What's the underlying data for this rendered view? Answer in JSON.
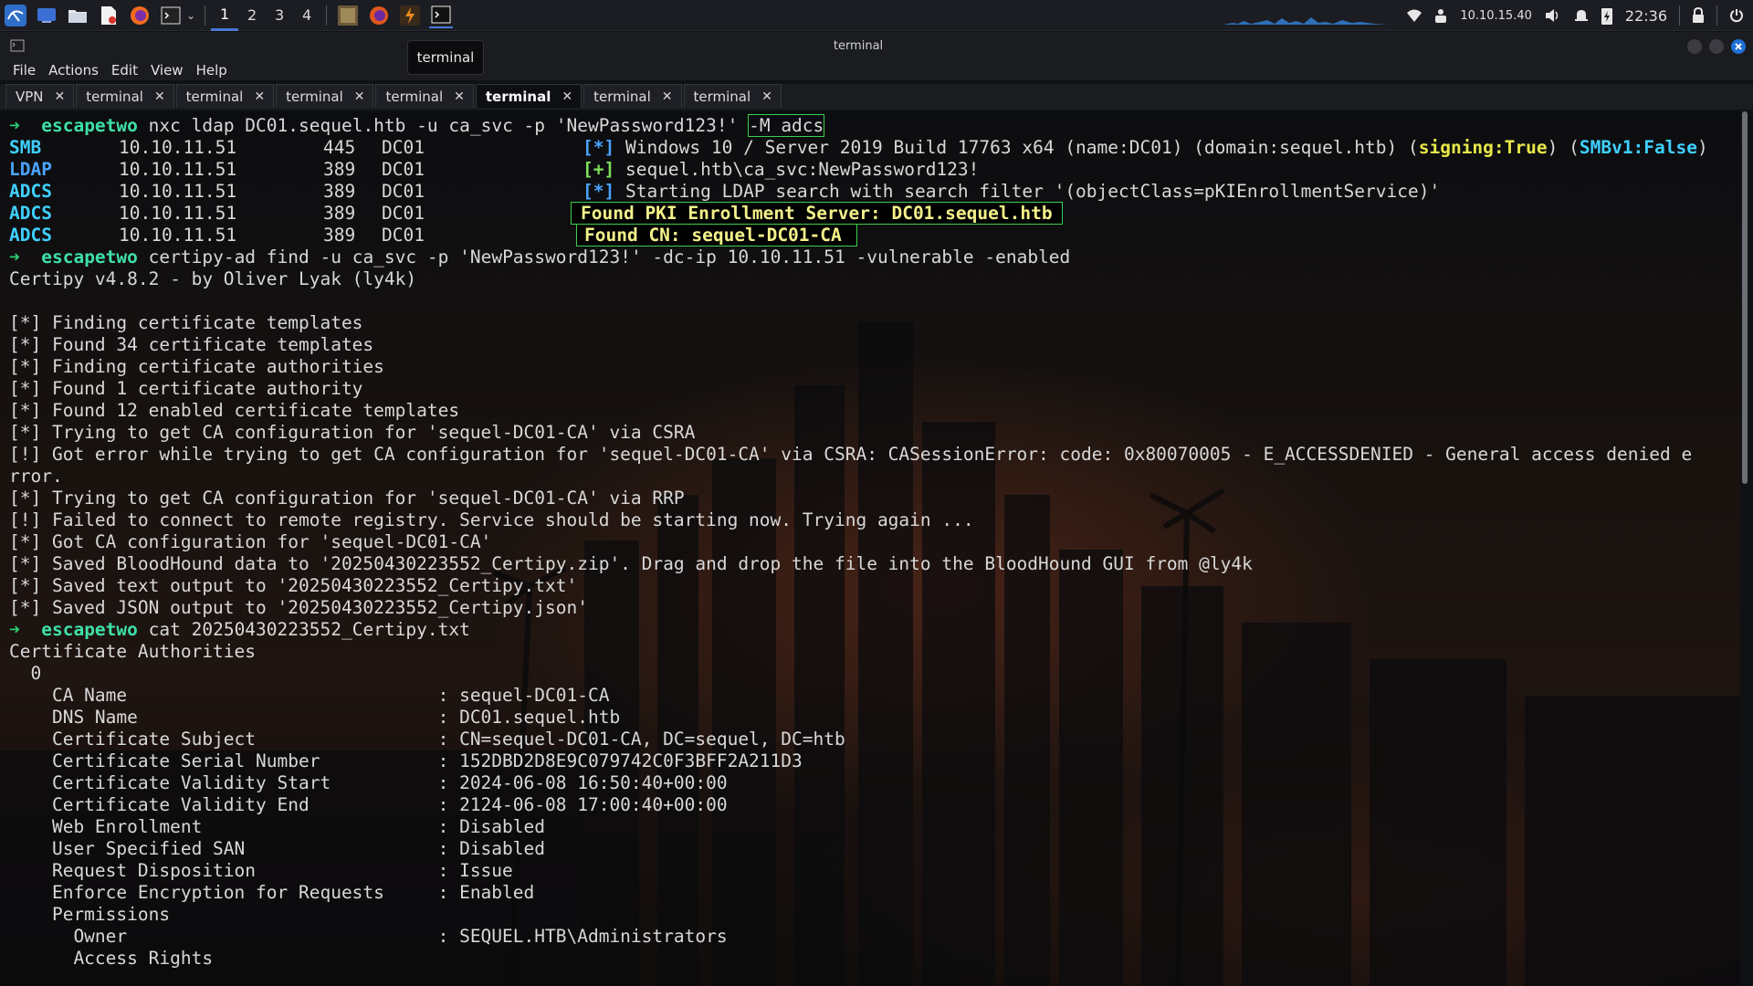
{
  "panel": {
    "workspaces": [
      "1",
      "2",
      "3",
      "4"
    ],
    "active_workspace": "1",
    "ip": "10.10.15.40",
    "clock": "22:36"
  },
  "window": {
    "title": "terminal",
    "tooltip": "terminal"
  },
  "menu": [
    "File",
    "Actions",
    "Edit",
    "View",
    "Help"
  ],
  "tabs": [
    {
      "label": "VPN"
    },
    {
      "label": "terminal"
    },
    {
      "label": "terminal"
    },
    {
      "label": "terminal"
    },
    {
      "label": "terminal"
    },
    {
      "label": "terminal",
      "active": true
    },
    {
      "label": "terminal"
    },
    {
      "label": "terminal"
    }
  ],
  "terminal": {
    "prompt_symbol": "➜",
    "hostname": "escapetwo",
    "cmd1": " nxc ldap DC01.sequel.htb -u ca_svc -p 'NewPassword123!' ",
    "cmd1_flag": "-M adcs",
    "nxc": [
      {
        "proto": "SMB",
        "ip": "10.10.11.51",
        "port": "445",
        "host": "DC01",
        "mark": "[*]",
        "msg_a": " Windows 10 / Server 2019 Build 17763 x64 (name:DC01) (domain:sequel.htb) (",
        "signing": "signing:True",
        "msg_b": ") (",
        "smbv1": "SMBv1:False",
        "msg_c": ")"
      },
      {
        "proto": "LDAP",
        "ip": "10.10.11.51",
        "port": "389",
        "host": "DC01",
        "mark": "[+]",
        "msg": " sequel.htb\\ca_svc:NewPassword123!"
      },
      {
        "proto": "ADCS",
        "ip": "10.10.11.51",
        "port": "389",
        "host": "DC01",
        "mark": "[*]",
        "msg": " Starting LDAP search with search filter '(objectClass=pKIEnrollmentService)'"
      },
      {
        "proto": "ADCS",
        "ip": "10.10.11.51",
        "port": "389",
        "host": "DC01",
        "found": "Found PKI Enrollment Server: DC01.sequel.htb"
      },
      {
        "proto": "ADCS",
        "ip": "10.10.11.51",
        "port": "389",
        "host": "DC01",
        "found": "Found CN: sequel-DC01-CA"
      }
    ],
    "cmd2": " certipy-ad find -u ca_svc -p 'NewPassword123!' -dc-ip 10.10.11.51 -vulnerable -enabled",
    "certipy_out": [
      "Certipy v4.8.2 - by Oliver Lyak (ly4k)",
      "",
      "[*] Finding certificate templates",
      "[*] Found 34 certificate templates",
      "[*] Finding certificate authorities",
      "[*] Found 1 certificate authority",
      "[*] Found 12 enabled certificate templates",
      "[*] Trying to get CA configuration for 'sequel-DC01-CA' via CSRA",
      "[!] Got error while trying to get CA configuration for 'sequel-DC01-CA' via CSRA: CASessionError: code: 0x80070005 - E_ACCESSDENIED - General access denied e",
      "rror.",
      "[*] Trying to get CA configuration for 'sequel-DC01-CA' via RRP",
      "[!] Failed to connect to remote registry. Service should be starting now. Trying again ...",
      "[*] Got CA configuration for 'sequel-DC01-CA'",
      "[*] Saved BloodHound data to '20250430223552_Certipy.zip'. Drag and drop the file into the BloodHound GUI from @ly4k",
      "[*] Saved text output to '20250430223552_Certipy.txt'",
      "[*] Saved JSON output to '20250430223552_Certipy.json'"
    ],
    "cmd3": " cat 20250430223552_Certipy.txt",
    "cat_out": [
      "Certificate Authorities",
      "  0",
      "    CA Name                             : sequel-DC01-CA",
      "    DNS Name                            : DC01.sequel.htb",
      "    Certificate Subject                 : CN=sequel-DC01-CA, DC=sequel, DC=htb",
      "    Certificate Serial Number           : 152DBD2D8E9C079742C0F3BFF2A211D3",
      "    Certificate Validity Start          : 2024-06-08 16:50:40+00:00",
      "    Certificate Validity End            : 2124-06-08 17:00:40+00:00",
      "    Web Enrollment                      : Disabled",
      "    User Specified SAN                  : Disabled",
      "    Request Disposition                 : Issue",
      "    Enforce Encryption for Requests     : Enabled",
      "    Permissions",
      "      Owner                             : SEQUEL.HTB\\Administrators",
      "      Access Rights"
    ]
  }
}
